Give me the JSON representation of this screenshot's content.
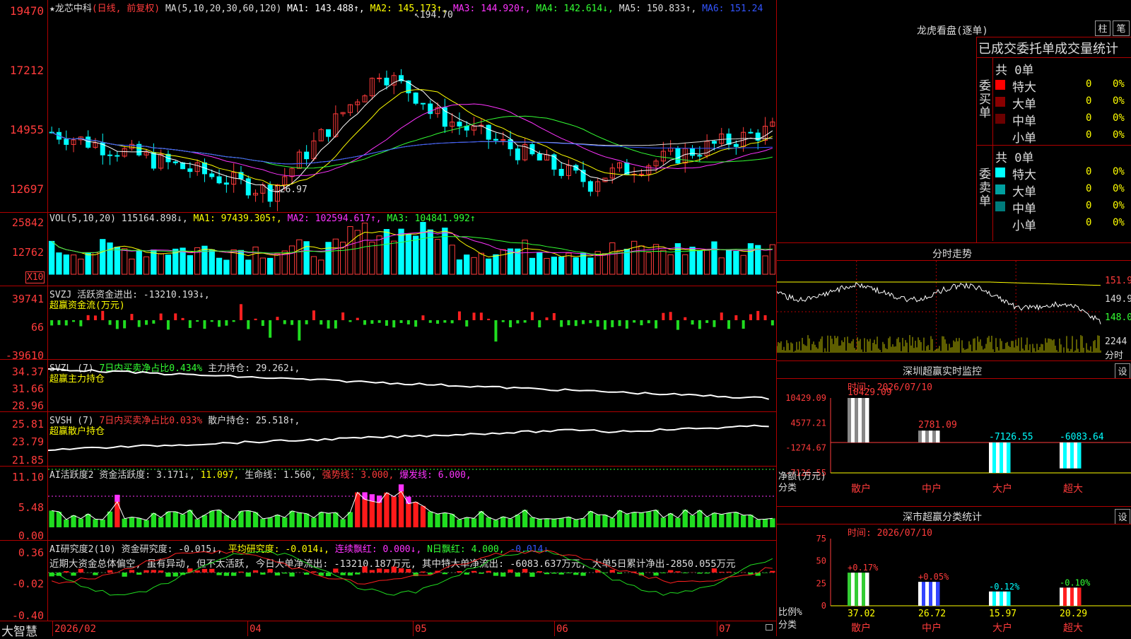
{
  "main_chart": {
    "title": "★龙芯中科",
    "mode": "(日线, 前复权)",
    "ma_header": "MA(5,10,20,30,60,120)",
    "ma1": "MA1: 143.488↑,",
    "ma2": "MA2: 145.173↑,",
    "ma3": "MA3: 144.920↑,",
    "ma4": "MA4: 142.614↓,",
    "ma5": "MA5: 150.833↑,",
    "ma6": "MA6: 151.24",
    "high_label": "194.70",
    "low_label": "126.97",
    "y_ticks": [
      "19470",
      "17212",
      "14955",
      "12697"
    ]
  },
  "volume_panel": {
    "header": "VOL(5,10,20)",
    "value": "115164.898↓,",
    "ma1": "MA1: 97439.305↑,",
    "ma2": "MA2: 102594.617↑,",
    "ma3": "MA3: 104841.992↑",
    "y_ticks": [
      "25842",
      "12762"
    ],
    "unit": "X10"
  },
  "svzj_panel": {
    "header": "SVZJ  活跃资金进出: -13210.193↓,",
    "subtitle": "超赢资金流(万元)",
    "y_ticks": [
      "39741",
      "66",
      "-39610"
    ]
  },
  "svzl_panel": {
    "header1": "SVZL (7)",
    "header2": "7日内买卖净占比0.434%",
    "header3": "主力持仓: 29.262↓,",
    "subtitle": "超赢主力持仓",
    "y_ticks": [
      "34.37",
      "31.66",
      "28.96"
    ]
  },
  "svsh_panel": {
    "header1": "SVSH (7)",
    "header2": "7日内买卖净占比0.033%",
    "header3": "散户持仓: 25.518↑,",
    "subtitle": "超赢散户持仓",
    "y_ticks": [
      "25.81",
      "23.79",
      "21.85"
    ]
  },
  "ai_active_panel": {
    "header1": "AI活跃度2 资金活跃度: 3.171↓,",
    "header2": "11.097,",
    "header3": "生命线: 1.560,",
    "header4": "强势线: 3.000,",
    "header5": "爆发线: 6.000,",
    "y_ticks": [
      "11.10",
      "5.48",
      "0.00"
    ]
  },
  "ai_research_panel": {
    "header1": "AI研究度2(10) 资金研究度: -0.015↓,",
    "header2": "平均研究度: -0.014↓,",
    "header3": "连续飘红: 0.000↓,",
    "header4": "N日飘红: 4.000,",
    "header5": "-0.014↓",
    "comment": "近期大资金总体偏空, 虽有异动, 但不太活跃, 今日大单净流出: -13210.187万元, 其中特大单净流出: -6083.637万元, 大单5日累计净出-2850.055万元",
    "y_ticks": [
      "0.36",
      "-0.02",
      "-0.40"
    ]
  },
  "date_axis": {
    "labels": [
      "2026/02",
      "04",
      "05",
      "06",
      "07"
    ]
  },
  "brand": "大智慧",
  "dragon_tiger": {
    "title": "龙虎看盘(逐单)",
    "btn_zhu": "柱",
    "btn_bi": "笔",
    "stats_title": "已成交委托单成交量统计",
    "buy_label": "委买单",
    "sell_label": "委卖单",
    "buy_total": "共 0单",
    "sell_total": "共 0单",
    "buy_rows": [
      {
        "name": "特大",
        "count": "0",
        "pct": "0%",
        "color": "#ff0000"
      },
      {
        "name": "大单",
        "count": "0",
        "pct": "0%",
        "color": "#8b0000"
      },
      {
        "name": "中单",
        "count": "0",
        "pct": "0%",
        "color": "#6b0000"
      },
      {
        "name": "小单",
        "count": "0",
        "pct": "0%",
        "color": ""
      }
    ],
    "sell_rows": [
      {
        "name": "特大",
        "count": "0",
        "pct": "0%",
        "color": "#00ffff"
      },
      {
        "name": "大单",
        "count": "0",
        "pct": "0%",
        "color": "#00a0a0"
      },
      {
        "name": "中单",
        "count": "0",
        "pct": "0%",
        "color": "#007b7b"
      },
      {
        "name": "小单",
        "count": "0",
        "pct": "0%",
        "color": ""
      }
    ]
  },
  "intraday": {
    "title": "分时走势",
    "y_ticks": [
      "151.9",
      "149.9",
      "148.0"
    ],
    "vol_value": "2244",
    "vol_label": "分时"
  },
  "sz_monitor": {
    "title": "深圳超赢实时监控",
    "set": "设",
    "time": "时间: 2026/07/10",
    "y_ticks": [
      "10429.09",
      "4577.21",
      "-1274.67",
      "-7126.55"
    ],
    "ylabel": "净额(万元)",
    "xlabel": "分类",
    "categories": [
      "散户",
      "中户",
      "大户",
      "超大"
    ],
    "values": [
      10429.09,
      2781.09,
      -7126.55,
      -6083.64
    ],
    "value_labels": [
      "10429.09",
      "2781.09",
      "-7126.55",
      "-6083.64"
    ]
  },
  "sz_class": {
    "title": "深市超赢分类统计",
    "set": "设",
    "time": "时间: 2026/07/10",
    "y_ticks": [
      "75",
      "50",
      "25",
      "0"
    ],
    "ylabel": "比例%",
    "xlabel": "分类",
    "categories": [
      "散户",
      "中户",
      "大户",
      "超大"
    ],
    "values": [
      37.02,
      26.72,
      15.97,
      20.29
    ],
    "value_labels": [
      "37.02",
      "26.72",
      "15.97",
      "20.29"
    ],
    "changes": [
      "+0.17%",
      "+0.05%",
      "-0.12%",
      "-0.10%"
    ]
  },
  "chart_data": [
    {
      "type": "bar",
      "title": "深圳超赢实时监控",
      "categories": [
        "散户",
        "中户",
        "大户",
        "超大"
      ],
      "values": [
        10429.09,
        2781.09,
        -7126.55,
        -6083.64
      ],
      "ylabel": "净额(万元)",
      "xlabel": "分类",
      "ylim": [
        -7126.55,
        10429.09
      ]
    },
    {
      "type": "bar",
      "title": "深市超赢分类统计",
      "categories": [
        "散户",
        "中户",
        "大户",
        "超大"
      ],
      "values": [
        37.02,
        26.72,
        15.97,
        20.29
      ],
      "ylabel": "比例%",
      "xlabel": "分类",
      "ylim": [
        0,
        75
      ]
    }
  ]
}
